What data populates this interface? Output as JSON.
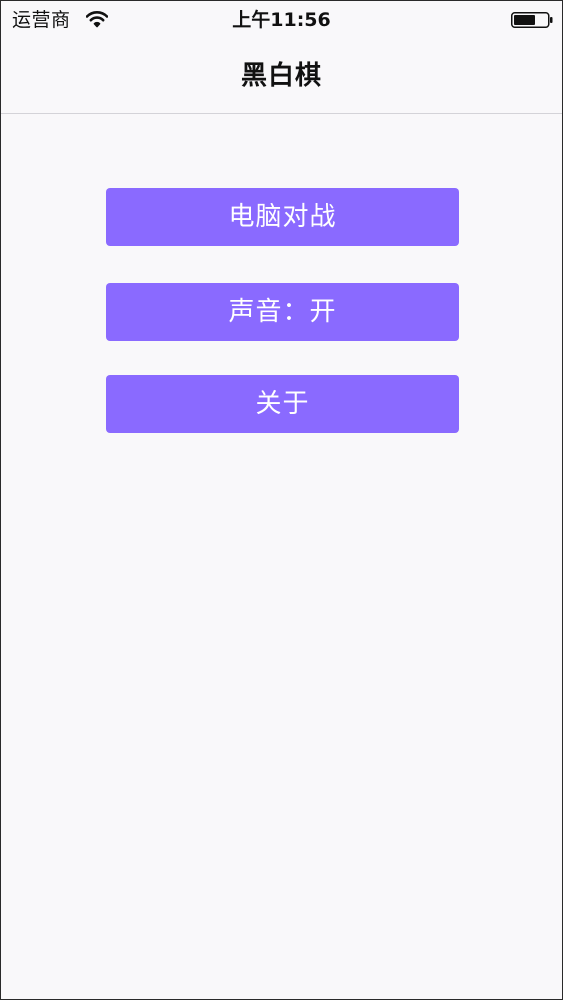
{
  "status_bar": {
    "carrier": "运营商",
    "time": "上午11:56",
    "wifi_icon": "wifi-icon",
    "battery_icon": "battery-icon"
  },
  "nav": {
    "title": "黑白棋"
  },
  "menu": {
    "computer_battle_label": "电脑对战",
    "sound_label": "声音：开",
    "about_label": "关于"
  },
  "colors": {
    "button_bg": "#8a6aff",
    "button_text": "#ffffff",
    "background": "#f9f8fa"
  }
}
